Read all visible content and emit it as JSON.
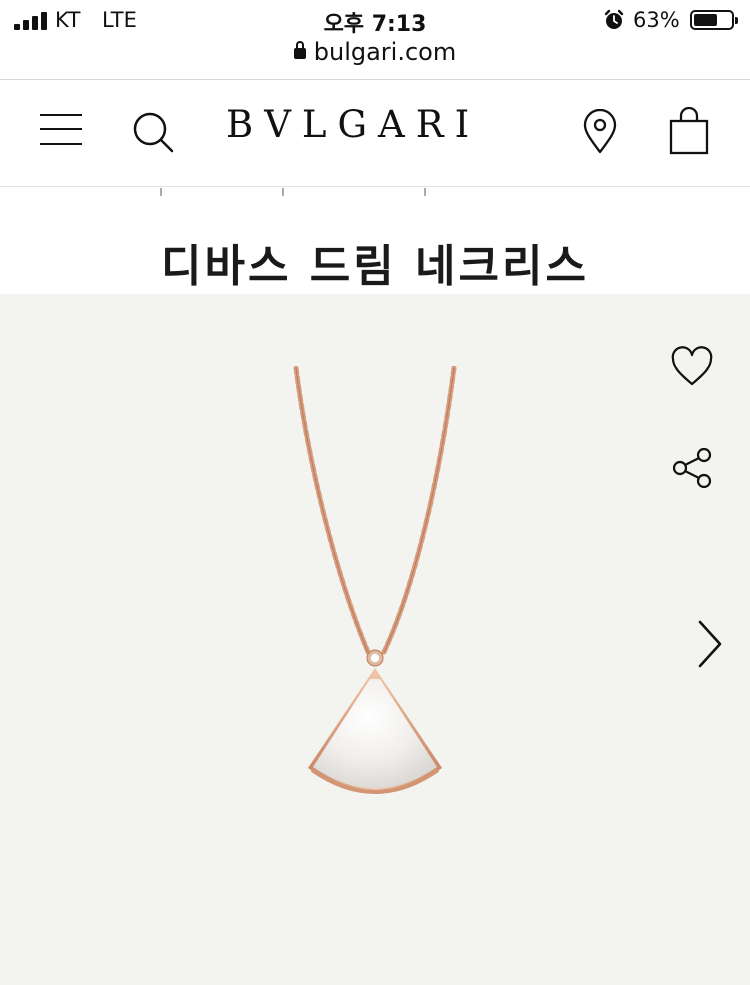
{
  "status_bar": {
    "carrier": "KT",
    "network": "LTE",
    "time": "오후 7:13",
    "url": "bulgari.com",
    "battery_percent_label": "63%",
    "battery_level": 0.63
  },
  "header": {
    "brand": "BVLGARI",
    "icons": [
      "hamburger-menu-icon",
      "search-icon",
      "location-pin-icon",
      "shopping-bag-icon"
    ]
  },
  "product": {
    "title": "디바스 드림 네크리스"
  },
  "gallery": {
    "background_color": "#f3f3f0",
    "metal_color": "#d9a383",
    "icons": [
      "heart-icon",
      "share-icon",
      "chevron-right-icon"
    ]
  }
}
